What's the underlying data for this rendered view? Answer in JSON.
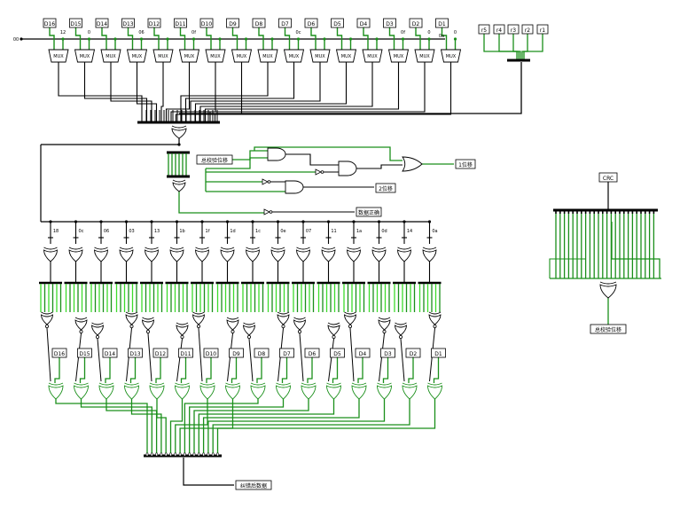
{
  "colors": {
    "wire_off": "#000000",
    "wire_on": "#1a8f1a",
    "bright": "#3ddc2c",
    "gate_fill": "#ffffff"
  },
  "inputs_top": [
    "D16",
    "D15",
    "D14",
    "D13",
    "D12",
    "D11",
    "D10",
    "D9",
    "D8",
    "D7",
    "D6",
    "D5",
    "D4",
    "D3",
    "D2",
    "D1"
  ],
  "top_bits": [
    "12",
    "0",
    "",
    "06",
    "",
    "0f",
    "",
    "",
    "",
    "0c",
    "",
    "",
    "",
    "0f",
    "0",
    "0"
  ],
  "bit_right": [
    "0a"
  ],
  "clock_label": "00",
  "mux_label": "MUX",
  "r_inputs": [
    "r5",
    "r4",
    "r3",
    "r2",
    "r1"
  ],
  "mid_labels": {
    "total_parity": "总校验位移",
    "out_1": "1位移",
    "out_2": "2位移",
    "data_error": "数据正确"
  },
  "hex_row": [
    "18",
    "0c",
    "06",
    "03",
    "13",
    "1b",
    "1f",
    "1d",
    "1c",
    "0e",
    "07",
    "11",
    "1a",
    "0d",
    "14",
    "0a"
  ],
  "outputs_bottom": [
    "D16",
    "D15",
    "D14",
    "D13",
    "D12",
    "D11",
    "D10",
    "D9",
    "D8",
    "D7",
    "D6",
    "D5",
    "D4",
    "D3",
    "D2",
    "D1"
  ],
  "final_label": "纠错后数据",
  "crc_label": "CRC",
  "crc_out_label": "总校验位移"
}
